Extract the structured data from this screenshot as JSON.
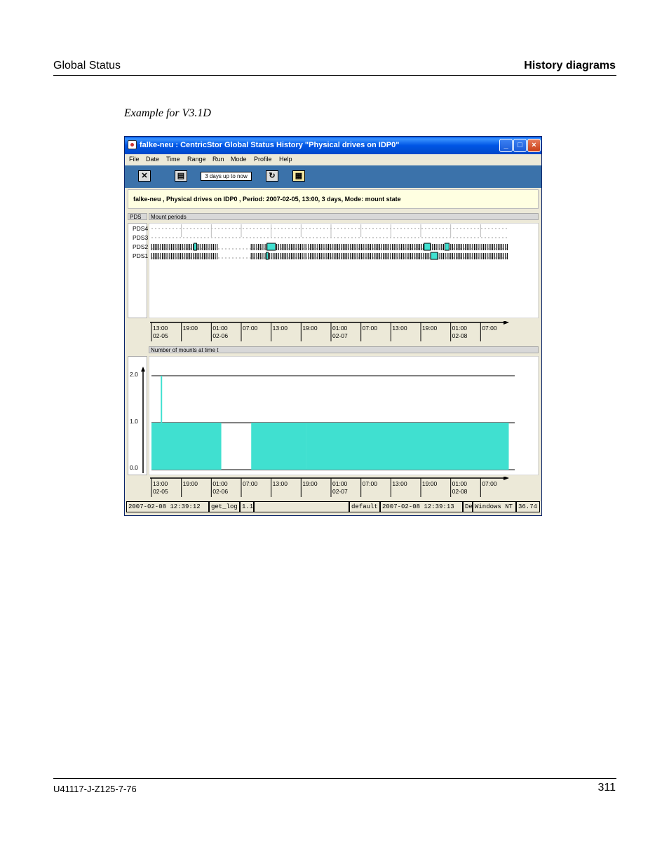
{
  "page": {
    "header_left": "Global Status",
    "header_right": "History diagrams",
    "caption": "Example for V3.1D",
    "footer_left": "U41117-J-Z125-7-76",
    "footer_right": "311"
  },
  "window": {
    "title": "falke-neu : CentricStor Global Status History \"Physical drives on IDP0\"",
    "controls": [
      "_",
      "□",
      "×"
    ],
    "menu": [
      "File",
      "Date",
      "Time",
      "Range",
      "Run",
      "Mode",
      "Profile",
      "Help"
    ],
    "toolbar": {
      "range_value": "3 days up to now",
      "icons": [
        "close-x-icon",
        "print-icon",
        "refresh-icon",
        "table-icon"
      ]
    },
    "info_line": "falke-neu , Physical drives on IDP0 , Period: 2007-02-05, 13:00, 3 days, Mode: mount state",
    "mount_section": {
      "left_label": "PDS",
      "title": "Mount periods",
      "drives": [
        "PDS4",
        "PDS3",
        "PDS2",
        "PDS1"
      ]
    },
    "count_section": {
      "title": "Number of mounts at time t"
    },
    "time_axis": {
      "times": [
        "13:00",
        "19:00",
        "01:00",
        "07:00",
        "13:00",
        "19:00",
        "01:00",
        "07:00",
        "13:00",
        "19:00",
        "01:00",
        "07:00"
      ],
      "dates": [
        "02-05",
        "",
        "02-06",
        "",
        "",
        "",
        "02-07",
        "",
        "",
        "",
        "02-08",
        ""
      ]
    },
    "status_bar": [
      "2007-02-08 12:39:12",
      "get_log",
      "1.1",
      "",
      "default",
      "2007-02-08 12:39:13",
      "De",
      "Windows NT",
      "36.74"
    ]
  },
  "colors": {
    "mount_fill": "#40e0d0",
    "title_bar": "#0055e5",
    "toolbar": "#3b72aa",
    "info_bg": "#ffffe1",
    "window_bg": "#ece9d8"
  },
  "chart_data": {
    "type": "area",
    "title": "Number of mounts at time t",
    "xlabel": "",
    "ylabel": "",
    "yticks": [
      "0.0",
      "1.0",
      "2.0"
    ],
    "ylim": [
      0,
      2
    ],
    "x_start": "2007-02-05 13:00",
    "x_end": "2007-02-08 13:00",
    "series": [
      {
        "segments": [
          {
            "from": "2007-02-05 13:00",
            "to": "2007-02-06 03:00",
            "value": 1
          },
          {
            "from": "2007-02-06 03:00",
            "to": "2007-02-06 09:00",
            "value": 0
          },
          {
            "from": "2007-02-06 09:00",
            "to": "2007-02-06 20:00",
            "value": 1
          },
          {
            "from": "2007-02-06 20:00",
            "to": "2007-02-08 12:39",
            "value": 1
          }
        ],
        "spikes": [
          {
            "at": "2007-02-05 15:00",
            "value": 2
          }
        ]
      }
    ],
    "reference_lines": [
      2,
      1
    ]
  }
}
